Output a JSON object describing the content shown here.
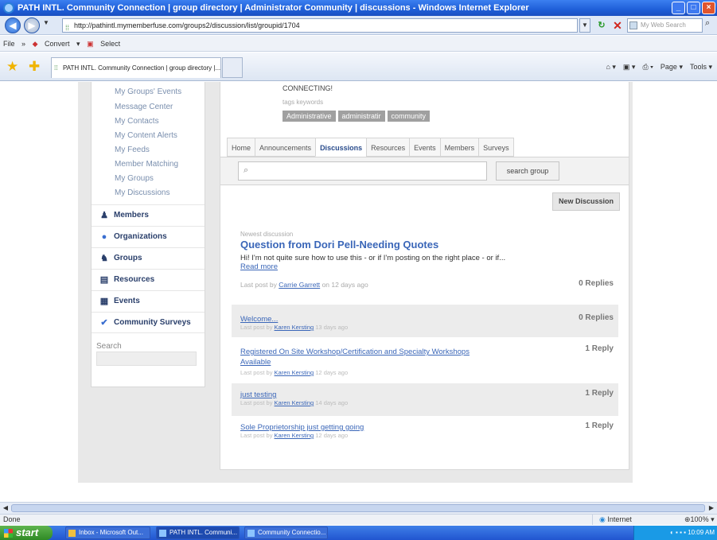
{
  "window": {
    "title": "PATH INTL. Community Connection | group directory | Administrator Community | discussions - Windows Internet Explorer"
  },
  "address": {
    "url": "http://pathintl.mymemberfuse.com/groups2/discussion/list/groupid/1704",
    "search_placeholder": "My Web Search"
  },
  "links_bar": {
    "file": "File",
    "convert": "Convert",
    "select": "Select"
  },
  "browser_tab": {
    "label": "PATH INTL. Community Connection | group directory |..."
  },
  "command_bar": {
    "page": "Page ▾",
    "tools": "Tools ▾"
  },
  "left_nav": {
    "sub_items": [
      "My Groups' Events",
      "Message Center",
      "My Contacts",
      "My Content Alerts",
      "My Feeds",
      "Member Matching",
      "My Groups",
      "My Discussions"
    ],
    "sections": [
      {
        "label": "Members",
        "icon": "person-icon"
      },
      {
        "label": "Organizations",
        "icon": "globe-icon"
      },
      {
        "label": "Groups",
        "icon": "group-icon"
      },
      {
        "label": "Resources",
        "icon": "document-icon"
      },
      {
        "label": "Events",
        "icon": "calendar-icon"
      },
      {
        "label": "Community Surveys",
        "icon": "checkmark-icon"
      }
    ],
    "search_label": "Search"
  },
  "group": {
    "connecting_text": "CONNECTING!",
    "tags_label": "tags keywords",
    "tags": [
      "Administrative",
      "administratir",
      "community"
    ]
  },
  "tabs": [
    "Home",
    "Announcements",
    "Discussions",
    "Resources",
    "Events",
    "Members",
    "Surveys"
  ],
  "active_tab": "Discussions",
  "search": {
    "button": "search group"
  },
  "new_discussion_label": "New Discussion",
  "featured": {
    "label": "Newest discussion",
    "title": "Question from Dori Pell-Needing Quotes",
    "snippet": "Hi! I'm not quite sure how to use this - or if I'm posting on the right place - or if...",
    "read_more": "Read more",
    "last_post_prefix": "Last post by",
    "author": "Carrie Garrett",
    "time": "on 12 days ago",
    "replies": "0 Replies"
  },
  "discussions": [
    {
      "title": "Welcome...",
      "prefix": "Last post by",
      "author": "Karen Kersting",
      "time": "13 days ago",
      "replies": "0 Replies"
    },
    {
      "title": "Registered On Site Workshop/Certification and Specialty Workshops Available",
      "prefix": "Last post by",
      "author": "Karen Kersting",
      "time": "12 days ago",
      "replies": "1 Reply"
    },
    {
      "title": "just testing",
      "prefix": "Last post by",
      "author": "Karen Kersting",
      "time": "14 days ago",
      "replies": "1 Reply"
    },
    {
      "title": "Sole Proprietorship just getting going",
      "prefix": "Last post by",
      "author": "Karen Kersting",
      "time": "12 days ago",
      "replies": "1 Reply"
    }
  ],
  "status": {
    "text": "Done",
    "zone": "Internet",
    "zoom": "100%"
  },
  "taskbar": {
    "start": "start",
    "tasks": [
      "Inbox - Microsoft Out...",
      "PATH INTL. Communi...",
      "Community Connectio..."
    ],
    "clock": "10:09 AM"
  }
}
